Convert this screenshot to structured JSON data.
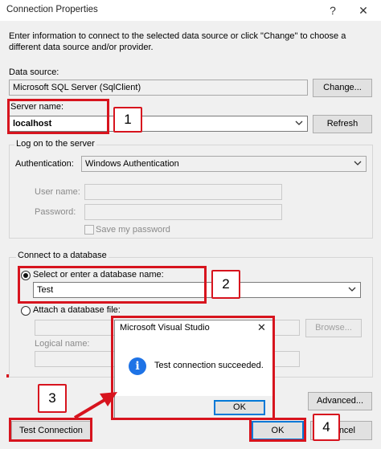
{
  "window": {
    "title": "Connection Properties",
    "help": "?",
    "close": "✕"
  },
  "intro": "Enter information to connect to the selected data source or click \"Change\" to choose a different data source and/or provider.",
  "data_source": {
    "label": "Data source:",
    "value": "Microsoft SQL Server (SqlClient)",
    "change_label": "Change..."
  },
  "server": {
    "label": "Server name:",
    "value": "localhost",
    "refresh_label": "Refresh"
  },
  "logon": {
    "title": "Log on to the server",
    "auth_label": "Authentication:",
    "auth_value": "Windows Authentication",
    "user_label": "User name:",
    "password_label": "Password:",
    "save_password_label": "Save my password"
  },
  "database": {
    "title": "Connect to a database",
    "select_label": "Select or enter a database name:",
    "select_value": "Test",
    "attach_label": "Attach a database file:",
    "browse_label": "Browse...",
    "logical_label": "Logical name:"
  },
  "advanced_label": "Advanced...",
  "test_connection_label": "Test Connection",
  "ok_label": "OK",
  "cancel_label_visible": "ncel",
  "messagebox": {
    "title": "Microsoft Visual Studio",
    "close": "✕",
    "icon_glyph": "i",
    "message": "Test connection succeeded.",
    "ok_label": "OK"
  },
  "annotations": {
    "b1": "1",
    "b2": "2",
    "b3": "3",
    "b4": "4"
  },
  "colors": {
    "annotation_red": "#d7141e",
    "info_blue": "#1e73e6",
    "focus_blue": "#0078d7"
  }
}
